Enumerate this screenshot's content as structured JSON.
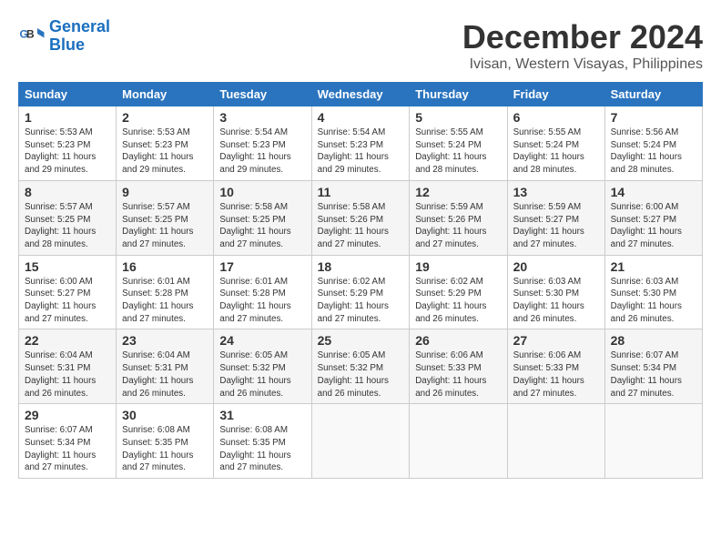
{
  "logo": {
    "line1": "General",
    "line2": "Blue"
  },
  "title": "December 2024",
  "location": "Ivisan, Western Visayas, Philippines",
  "weekdays": [
    "Sunday",
    "Monday",
    "Tuesday",
    "Wednesday",
    "Thursday",
    "Friday",
    "Saturday"
  ],
  "weeks": [
    [
      {
        "day": "1",
        "sunrise": "5:53 AM",
        "sunset": "5:23 PM",
        "daylight": "11 hours and 29 minutes."
      },
      {
        "day": "2",
        "sunrise": "5:53 AM",
        "sunset": "5:23 PM",
        "daylight": "11 hours and 29 minutes."
      },
      {
        "day": "3",
        "sunrise": "5:54 AM",
        "sunset": "5:23 PM",
        "daylight": "11 hours and 29 minutes."
      },
      {
        "day": "4",
        "sunrise": "5:54 AM",
        "sunset": "5:23 PM",
        "daylight": "11 hours and 29 minutes."
      },
      {
        "day": "5",
        "sunrise": "5:55 AM",
        "sunset": "5:24 PM",
        "daylight": "11 hours and 28 minutes."
      },
      {
        "day": "6",
        "sunrise": "5:55 AM",
        "sunset": "5:24 PM",
        "daylight": "11 hours and 28 minutes."
      },
      {
        "day": "7",
        "sunrise": "5:56 AM",
        "sunset": "5:24 PM",
        "daylight": "11 hours and 28 minutes."
      }
    ],
    [
      {
        "day": "8",
        "sunrise": "5:57 AM",
        "sunset": "5:25 PM",
        "daylight": "11 hours and 28 minutes."
      },
      {
        "day": "9",
        "sunrise": "5:57 AM",
        "sunset": "5:25 PM",
        "daylight": "11 hours and 27 minutes."
      },
      {
        "day": "10",
        "sunrise": "5:58 AM",
        "sunset": "5:25 PM",
        "daylight": "11 hours and 27 minutes."
      },
      {
        "day": "11",
        "sunrise": "5:58 AM",
        "sunset": "5:26 PM",
        "daylight": "11 hours and 27 minutes."
      },
      {
        "day": "12",
        "sunrise": "5:59 AM",
        "sunset": "5:26 PM",
        "daylight": "11 hours and 27 minutes."
      },
      {
        "day": "13",
        "sunrise": "5:59 AM",
        "sunset": "5:27 PM",
        "daylight": "11 hours and 27 minutes."
      },
      {
        "day": "14",
        "sunrise": "6:00 AM",
        "sunset": "5:27 PM",
        "daylight": "11 hours and 27 minutes."
      }
    ],
    [
      {
        "day": "15",
        "sunrise": "6:00 AM",
        "sunset": "5:27 PM",
        "daylight": "11 hours and 27 minutes."
      },
      {
        "day": "16",
        "sunrise": "6:01 AM",
        "sunset": "5:28 PM",
        "daylight": "11 hours and 27 minutes."
      },
      {
        "day": "17",
        "sunrise": "6:01 AM",
        "sunset": "5:28 PM",
        "daylight": "11 hours and 27 minutes."
      },
      {
        "day": "18",
        "sunrise": "6:02 AM",
        "sunset": "5:29 PM",
        "daylight": "11 hours and 27 minutes."
      },
      {
        "day": "19",
        "sunrise": "6:02 AM",
        "sunset": "5:29 PM",
        "daylight": "11 hours and 26 minutes."
      },
      {
        "day": "20",
        "sunrise": "6:03 AM",
        "sunset": "5:30 PM",
        "daylight": "11 hours and 26 minutes."
      },
      {
        "day": "21",
        "sunrise": "6:03 AM",
        "sunset": "5:30 PM",
        "daylight": "11 hours and 26 minutes."
      }
    ],
    [
      {
        "day": "22",
        "sunrise": "6:04 AM",
        "sunset": "5:31 PM",
        "daylight": "11 hours and 26 minutes."
      },
      {
        "day": "23",
        "sunrise": "6:04 AM",
        "sunset": "5:31 PM",
        "daylight": "11 hours and 26 minutes."
      },
      {
        "day": "24",
        "sunrise": "6:05 AM",
        "sunset": "5:32 PM",
        "daylight": "11 hours and 26 minutes."
      },
      {
        "day": "25",
        "sunrise": "6:05 AM",
        "sunset": "5:32 PM",
        "daylight": "11 hours and 26 minutes."
      },
      {
        "day": "26",
        "sunrise": "6:06 AM",
        "sunset": "5:33 PM",
        "daylight": "11 hours and 26 minutes."
      },
      {
        "day": "27",
        "sunrise": "6:06 AM",
        "sunset": "5:33 PM",
        "daylight": "11 hours and 27 minutes."
      },
      {
        "day": "28",
        "sunrise": "6:07 AM",
        "sunset": "5:34 PM",
        "daylight": "11 hours and 27 minutes."
      }
    ],
    [
      {
        "day": "29",
        "sunrise": "6:07 AM",
        "sunset": "5:34 PM",
        "daylight": "11 hours and 27 minutes."
      },
      {
        "day": "30",
        "sunrise": "6:08 AM",
        "sunset": "5:35 PM",
        "daylight": "11 hours and 27 minutes."
      },
      {
        "day": "31",
        "sunrise": "6:08 AM",
        "sunset": "5:35 PM",
        "daylight": "11 hours and 27 minutes."
      },
      null,
      null,
      null,
      null
    ]
  ]
}
